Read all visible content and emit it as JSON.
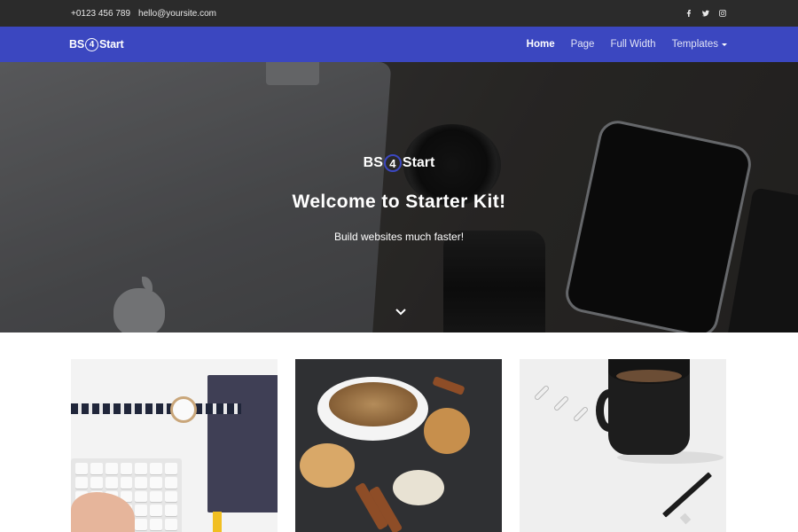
{
  "topbar": {
    "phone": "+0123 456 789",
    "email": "hello@yoursite.com",
    "social": [
      "facebook-icon",
      "twitter-icon",
      "instagram-icon"
    ]
  },
  "navbar": {
    "logo_pre": "BS",
    "logo_num": "4",
    "logo_post": "Start",
    "items": [
      {
        "label": "Home",
        "active": true
      },
      {
        "label": "Page",
        "active": false
      },
      {
        "label": "Full Width",
        "active": false
      },
      {
        "label": "Templates",
        "active": false,
        "dropdown": true
      }
    ]
  },
  "hero": {
    "logo_pre": "BS",
    "logo_num": "4",
    "logo_post": "Start",
    "title": "Welcome to Starter Kit!",
    "subtitle": "Build websites much faster!",
    "scroll_icon": "chevron-down-icon"
  },
  "cards": [
    {
      "image": "desk-keyboard-watch-notebook-photo"
    },
    {
      "image": "coffee-cookies-cinnamon-photo"
    },
    {
      "image": "black-mug-paperclips-pencil-photo"
    }
  ],
  "colors": {
    "topbar_bg": "#2b2b2b",
    "navbar_bg": "#3b47c0",
    "accent": "#3b47c0",
    "text_light": "#ffffff"
  }
}
